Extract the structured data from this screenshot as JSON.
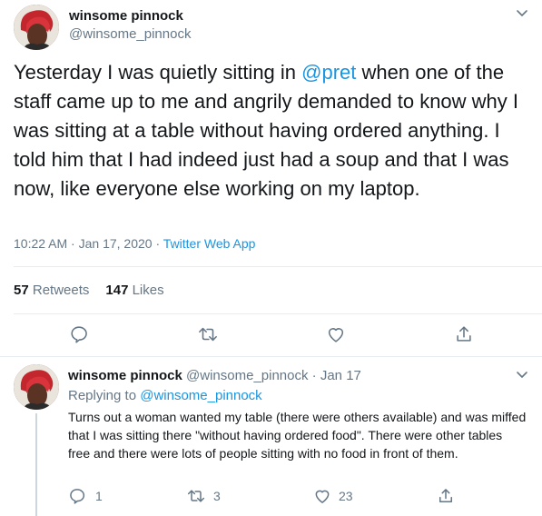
{
  "main_tweet": {
    "author_name": "winsome pinnock",
    "author_handle": "@winsome_pinnock",
    "text_before": "Yesterday I was quietly sitting in ",
    "mention": "@pret",
    "text_after": " when one of the staff came up to me and angrily demanded to know why I was sitting at a table without having ordered anything.  I told him that I had indeed just had a soup and that I was now, like everyone else working on my laptop.",
    "time": "10:22 AM",
    "date": "Jan 17, 2020",
    "dot": "·",
    "source": "Twitter Web App",
    "retweets_count": "57",
    "retweets_label": "Retweets",
    "likes_count": "147",
    "likes_label": "Likes"
  },
  "reply_tweet": {
    "author_name": "winsome pinnock",
    "author_handle": "@winsome_pinnock",
    "dot": "·",
    "date": "Jan 17",
    "replying_label": "Replying to ",
    "replying_to": "@winsome_pinnock",
    "text": "Turns out a woman wanted my table (there were others available) and was miffed that I was sitting there \"without having ordered food\".  There were other tables free and there were lots of people sitting with no food in front of them.",
    "reply_count": "1",
    "retweet_count": "3",
    "like_count": "23"
  },
  "icons": {
    "reply": "reply-icon",
    "retweet": "retweet-icon",
    "like": "heart-icon",
    "share": "share-icon",
    "more": "chevron-down-icon"
  },
  "colors": {
    "link": "#1b95e0",
    "muted": "#657786",
    "text": "#14171a",
    "divider": "#e6ecf0"
  }
}
